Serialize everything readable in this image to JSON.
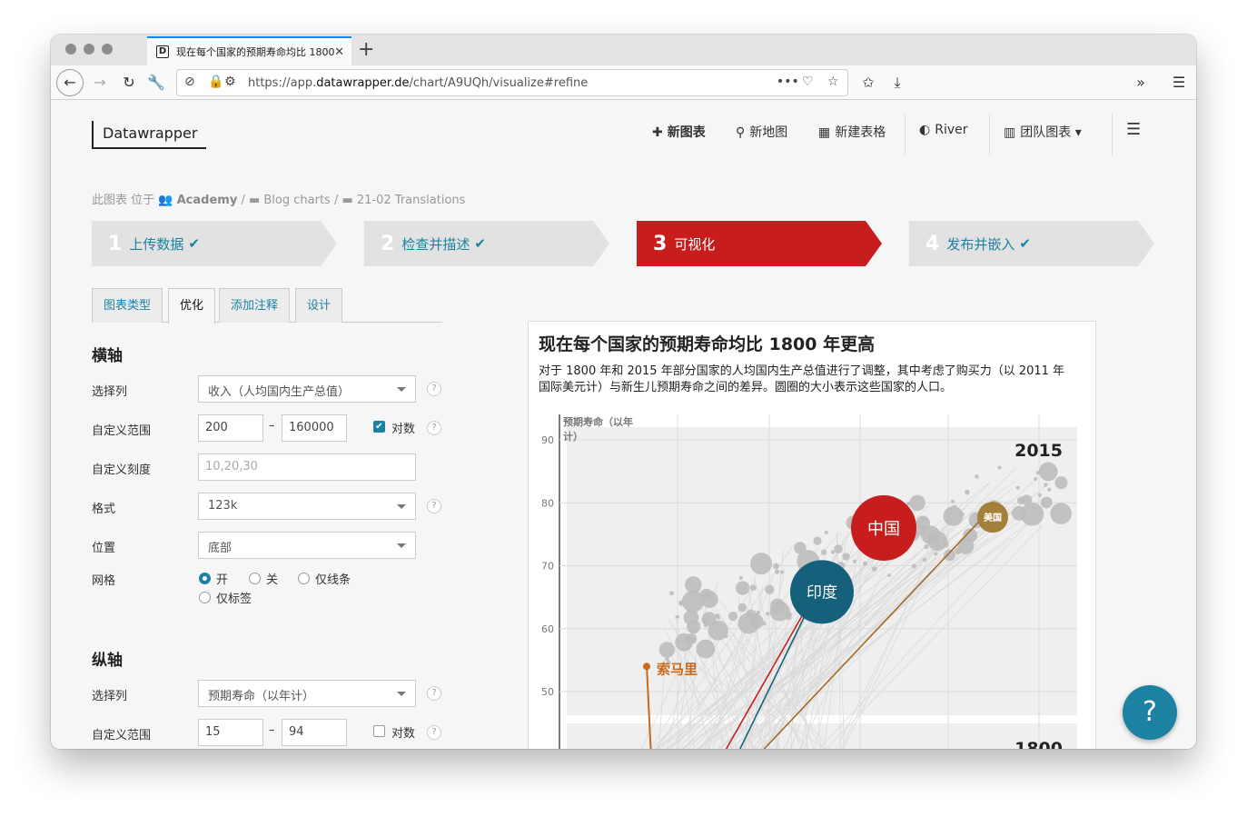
{
  "browser": {
    "tab_title": "现在每个国家的预期寿命均比 1800",
    "tab_favicon": "D",
    "url_prefix": "https://app.",
    "url_domain": "datawrapper.de",
    "url_path": "/chart/A9UQh/visualize#refine"
  },
  "header": {
    "logo": "Datawrapper",
    "nav": [
      {
        "icon": "plus-icon",
        "label": "新图表"
      },
      {
        "icon": "map-pin-icon",
        "label": "新地图"
      },
      {
        "icon": "table-icon",
        "label": "新建表格"
      },
      {
        "icon": "river-icon",
        "label": "River"
      },
      {
        "icon": "team-chart-icon",
        "label": "团队图表"
      }
    ]
  },
  "breadcrumb": {
    "prefix": "此图表 位于",
    "team": "Academy",
    "folder1": "Blog charts",
    "folder2": "21-02 Translations"
  },
  "steps": [
    {
      "num": "1",
      "label": "上传数据"
    },
    {
      "num": "2",
      "label": "检查并描述"
    },
    {
      "num": "3",
      "label": "可视化"
    },
    {
      "num": "4",
      "label": "发布并嵌入"
    }
  ],
  "tabs": [
    "图表类型",
    "优化",
    "添加注释",
    "设计"
  ],
  "x_axis": {
    "heading": "横轴",
    "column_label": "选择列",
    "column_value": "收入（人均国内生产总值）",
    "range_label": "自定义范围",
    "range_min": "200",
    "range_max": "160000",
    "log_label": "对数",
    "ticks_label": "自定义刻度",
    "ticks_placeholder": "10,20,30",
    "format_label": "格式",
    "format_value": "123k",
    "position_label": "位置",
    "position_value": "底部",
    "grid_label": "网格",
    "grid_options": [
      "开",
      "关",
      "仅线条",
      "仅标签"
    ]
  },
  "y_axis": {
    "heading": "纵轴",
    "column_label": "选择列",
    "column_value": "预期寿命（以年计）",
    "range_label": "自定义范围",
    "range_min": "15",
    "range_max": "94",
    "log_label": "对数"
  },
  "chart": {
    "title": "现在每个国家的预期寿命均比 1800 年更高",
    "description": "对于 1800 年和 2015 年部分国家的人均国内生产总值进行了调整，其中考虑了购买力（以 2011 年国际美元计）与新生儿预期寿命之间的差异。圆圈的大小表示这些国家的人口。",
    "ylabel": "预期寿命（以年计）",
    "panel_2015": "2015",
    "panel_1800": "1800",
    "labels": {
      "china": "中国",
      "india": "印度",
      "usa": "美国",
      "somalia": "索马里"
    }
  },
  "chart_data": {
    "type": "scatter",
    "title": "现在每个国家的预期寿命均比 1800 年更高",
    "ylabel": "预期寿命（以年计）",
    "y_ticks": [
      90,
      80,
      70,
      60,
      50
    ],
    "ylim": [
      15,
      94
    ],
    "xlim": [
      200,
      160000
    ],
    "x_scale": "log",
    "highlighted_2015": [
      {
        "name": "中国",
        "life_expectancy": 76
      },
      {
        "name": "印度",
        "life_expectancy": 68
      },
      {
        "name": "美国",
        "life_expectancy": 79
      },
      {
        "name": "索马里",
        "life_expectancy": 54
      }
    ]
  },
  "help_button": "?"
}
